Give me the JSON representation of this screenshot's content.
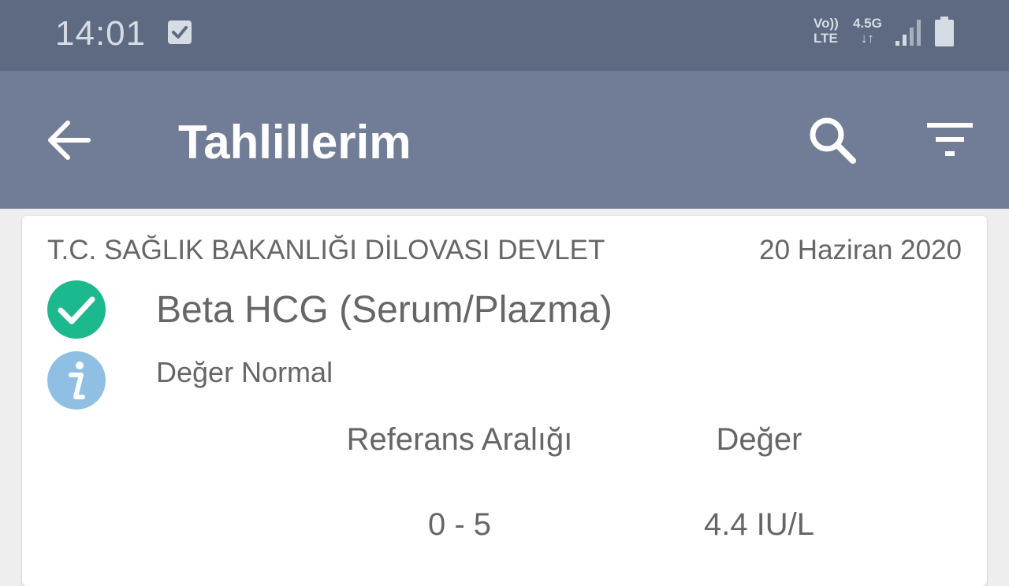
{
  "status_bar": {
    "time": "14:01",
    "volte_top": "Vo))",
    "volte_bottom": "LTE",
    "network_top": "4.5G",
    "network_bottom": "↓↑",
    "icons": [
      "checkbox-notification-icon",
      "signal-icon",
      "battery-icon"
    ]
  },
  "app_bar": {
    "title": "Tahlillerim",
    "icons": [
      "back-arrow-icon",
      "search-icon",
      "filter-icon"
    ]
  },
  "result_card": {
    "hospital": "T.C. SAĞLIK BAKANLIĞI DİLOVASI DEVLET",
    "date": "20 Haziran 2020",
    "test_name": "Beta HCG (Serum/Plazma)",
    "result_status": "Değer Normal",
    "reference_header": "Referans Aralığı",
    "value_header": "Değer",
    "reference_value": "0 - 5",
    "value": "4.4 IU/L"
  },
  "colors": {
    "status_bar": "#5e6a82",
    "app_bar": "#717c96",
    "ok_green": "#1cb98e",
    "info_blue": "#8fc0e4"
  }
}
